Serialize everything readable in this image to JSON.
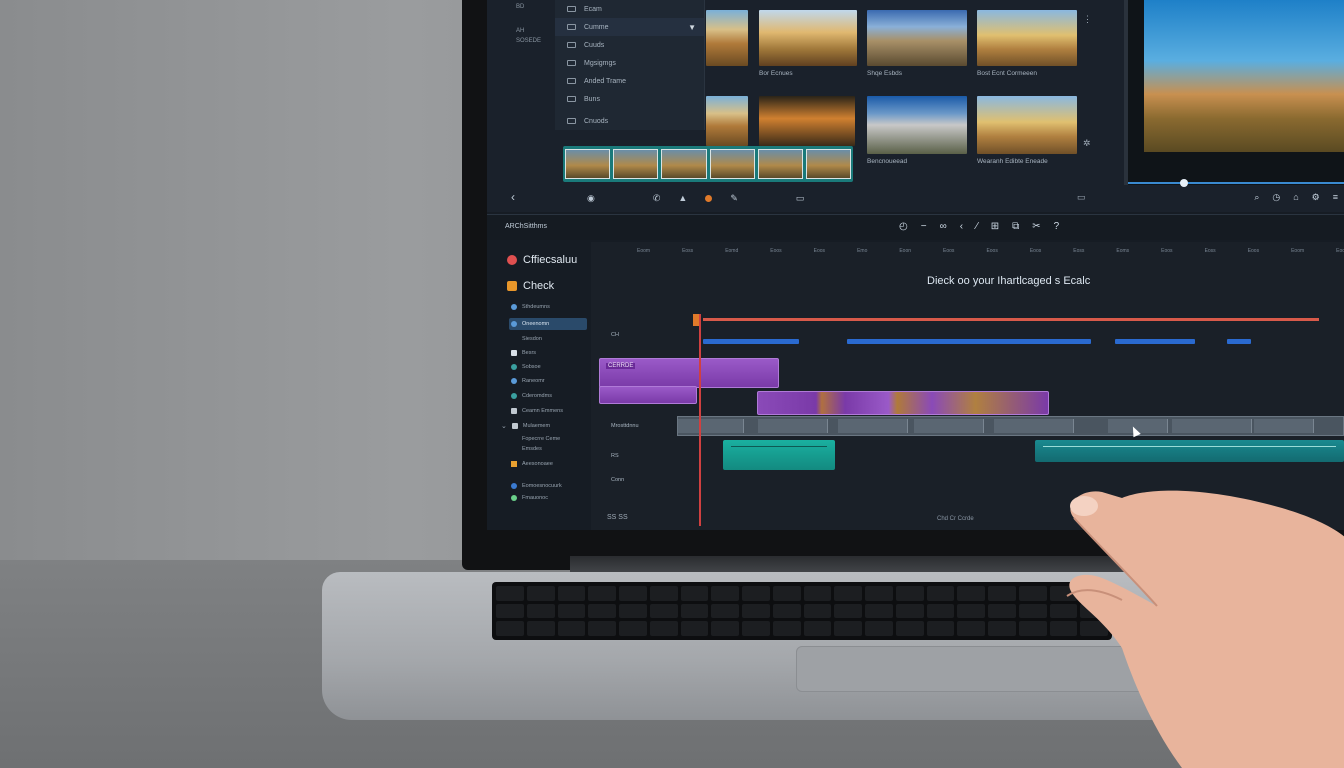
{
  "media_menu": {
    "items": [
      "Ecam",
      "Cumme",
      "Cuuds",
      "Mgsigmgs",
      "Anded Trame",
      "Buns",
      "Cnuods"
    ],
    "selected": "Cumme"
  },
  "left_strip": [
    "BD",
    "AH",
    "SOSEDE"
  ],
  "thumbnails": [
    {
      "caption": "Bor Ecnues"
    },
    {
      "caption": "Shqe Esbds"
    },
    {
      "caption": "Bost Ecnt Cormeeen"
    },
    {
      "caption": ""
    },
    {
      "caption": ""
    },
    {
      "caption": "Bencnoueead"
    },
    {
      "caption": "Wearanh Edibte Eneade"
    }
  ],
  "timeline": {
    "title": "ARChSitthms",
    "heading": "Dieck oo your Ihartlcaged s Ecalc",
    "ruler_ticks": [
      "Eoom",
      "Eoss",
      "Eomd",
      "Eoos",
      "Eoos",
      "Emo",
      "Eoon",
      "Eoos",
      "Eoos",
      "Eoos",
      "Eoss",
      "Eoms",
      "Eoos",
      "Eoss",
      "Eoos",
      "Eoom",
      "Eoos"
    ],
    "track_labels": [
      "CH",
      "Mrosttdnnu",
      "RS",
      "Conn"
    ],
    "clip_label": "CERRDE",
    "footer_left": "SS SS",
    "footer_center": "Chd Cr Ccrde"
  },
  "sidebar": {
    "primary": [
      {
        "label": "Cffiecsaluu",
        "color": "#e05050"
      },
      {
        "label": "Check",
        "color": "#e8962a"
      }
    ],
    "items": [
      "Sthdeumns",
      "Oneenomn",
      "Siesdon",
      "Besrs",
      "Sobsoe",
      "Raneomr",
      "Cderomdms",
      "Ceamn Emmens",
      "Mulaemem",
      "Fopecrre Ceme",
      "Emsdes",
      "Aeesonoaee",
      "Eomoesnocuurk",
      "Fmauonoc"
    ],
    "selected": "Oneenomn"
  },
  "icons": {
    "tools": [
      "undo-icon",
      "minus-icon",
      "link-icon",
      "share-icon",
      "pen-icon",
      "grid-icon",
      "copy-icon",
      "cut-icon",
      "help-icon"
    ],
    "preview": [
      "search-icon",
      "clock-icon",
      "bell-icon",
      "gear-icon",
      "menu-icon"
    ]
  },
  "colors": {
    "accent_orange": "#e8a030",
    "playhead_red": "#d04040",
    "clip_purple": "#8a4ab8",
    "clip_teal": "#16a096",
    "clip_blue": "#2a6ad0"
  }
}
